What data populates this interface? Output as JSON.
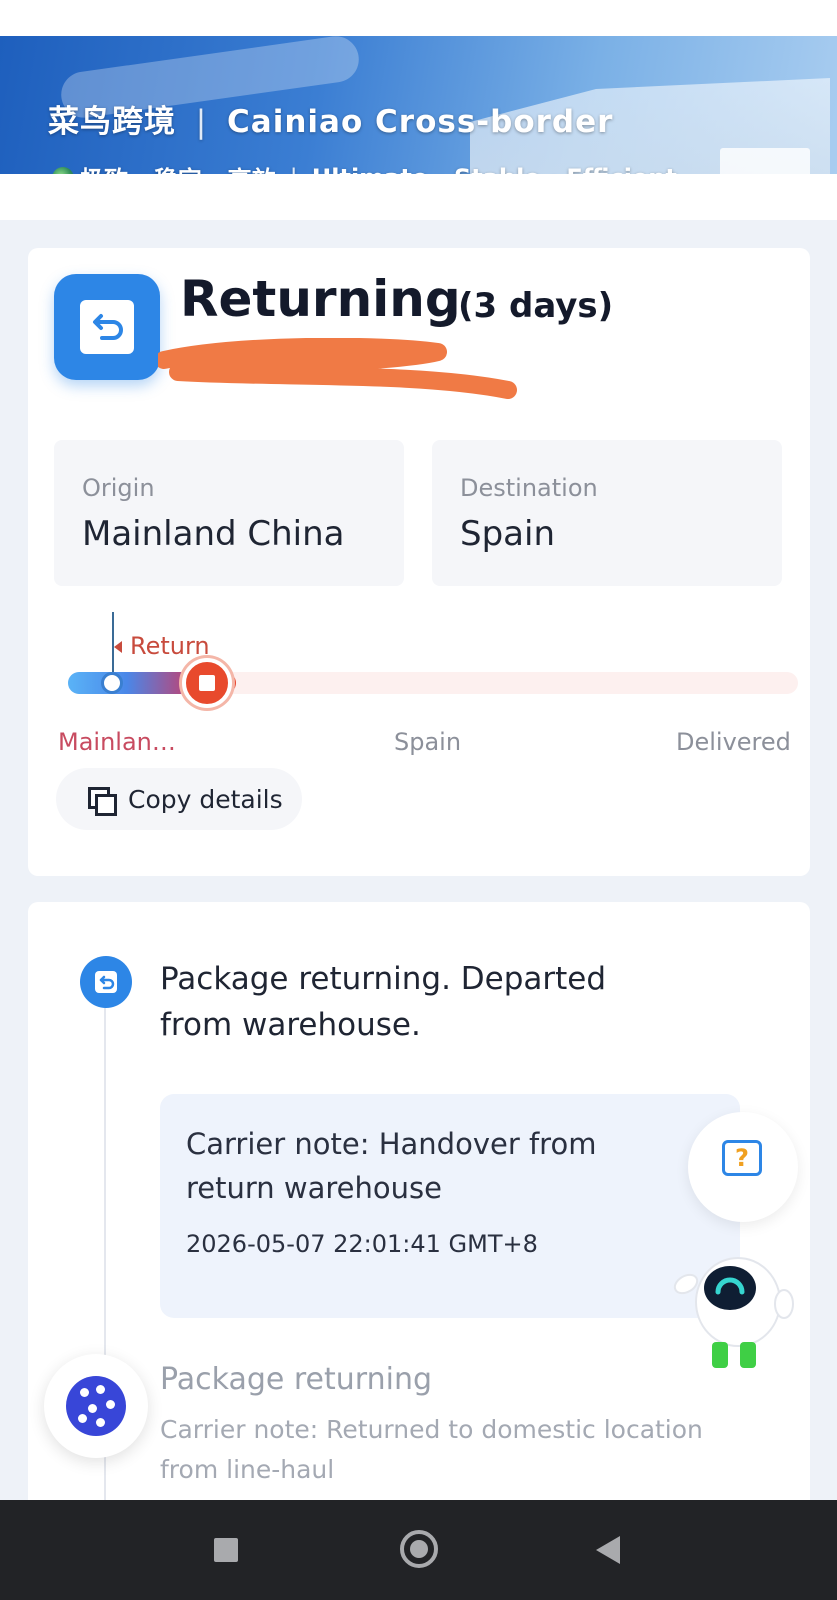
{
  "banner": {
    "title_cn": "菜鸟跨境",
    "title_sep": "|",
    "title_en": "Cainiao Cross-border",
    "subtitle_cn": "极致 · 稳定 · 高效",
    "subtitle_sep": "|",
    "subtitle_en": "Ultimate · Stable · Efficient"
  },
  "status": {
    "title": "Returning",
    "duration": "(3 days)",
    "icon": "return-arrow-icon",
    "accent_color": "#2d86e6",
    "origin_label": "Origin",
    "origin_value": "Mainland China",
    "destination_label": "Destination",
    "destination_value": "Spain"
  },
  "progress": {
    "flag_label": "Return",
    "stages": [
      "Mainlan…",
      "Spain",
      "Delivered"
    ],
    "current_stage_index": 0,
    "fill_fraction": 0.23,
    "colors": {
      "start": "#5ab3f7",
      "end": "#e8452c"
    }
  },
  "actions": {
    "copy_label": "Copy details"
  },
  "timeline": {
    "events": [
      {
        "title": "Package returning. Departed from warehouse.",
        "note": "Carrier note: Handover from return warehouse",
        "time": "2026-05-07 22:01:41 GMT+8"
      },
      {
        "title": "Package returning",
        "note": "Carrier note: Returned to domestic location from line-haul"
      }
    ]
  },
  "floating": {
    "help_icon": "question-chat-icon",
    "mascot": "robot-assistant",
    "cookie_icon": "cookie-icon"
  },
  "navbar": {
    "items": [
      "recents-button",
      "home-button",
      "back-button"
    ]
  }
}
